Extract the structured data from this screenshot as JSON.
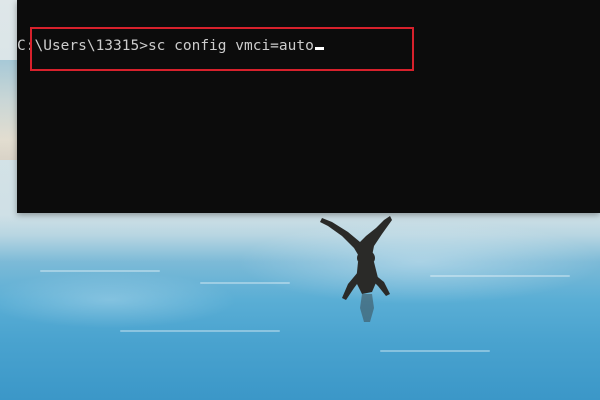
{
  "console": {
    "prompt": "C:\\Users\\13315>",
    "command": "sc config vmci=auto"
  },
  "colors": {
    "console_bg": "#0c0c0c",
    "console_text": "#cccccc",
    "highlight": "#d7212c"
  },
  "icons": {
    "cursor": "text-cursor-icon"
  }
}
